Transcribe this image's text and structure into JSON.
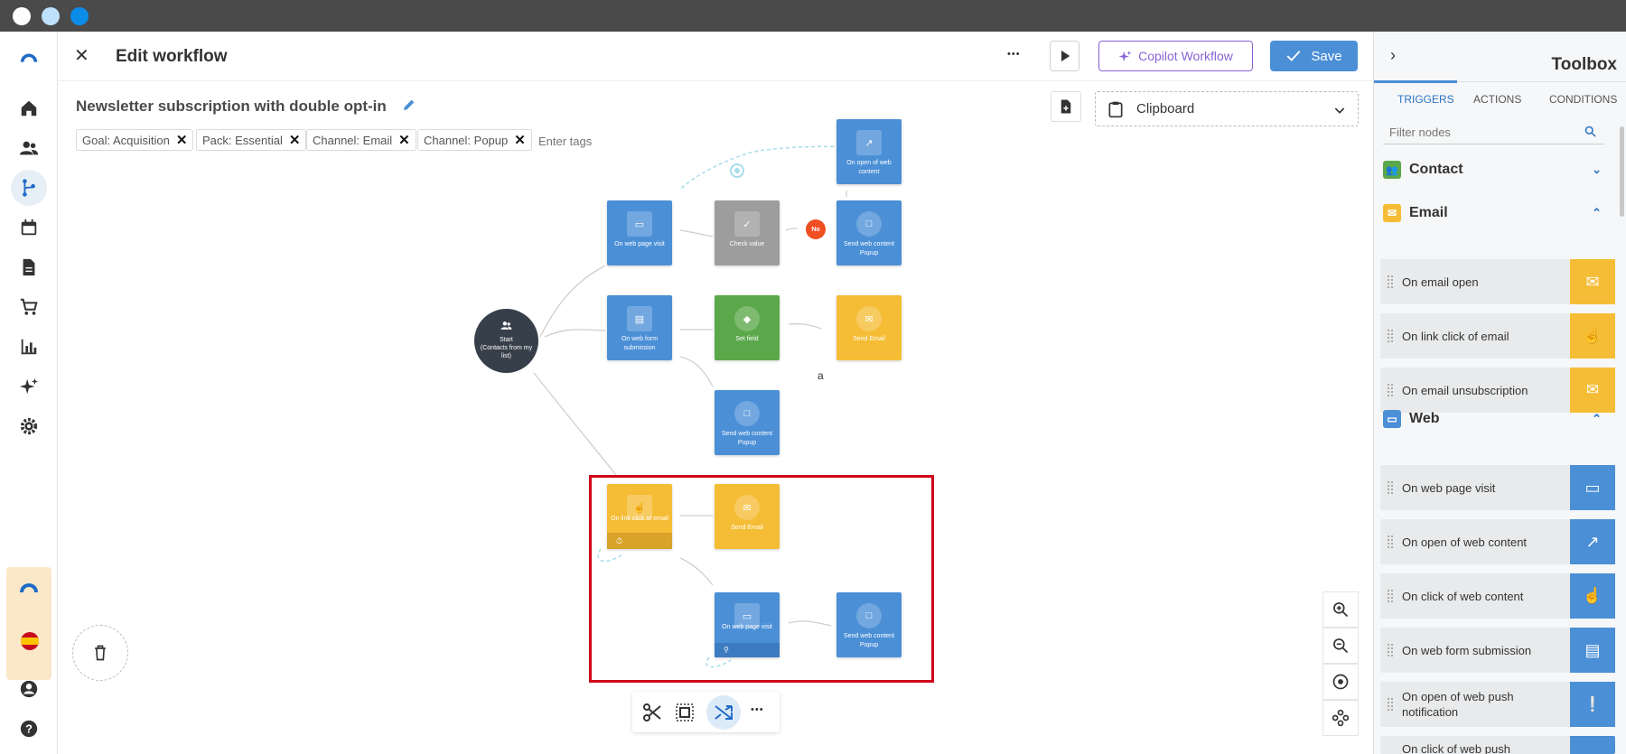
{
  "window": {
    "dots": [
      "#ffffff",
      "#bde0fb",
      "#0c8ce9"
    ]
  },
  "header": {
    "close_label": "✕",
    "title": "Edit workflow",
    "more_label": "•••",
    "copilot_label": "Copilot Workflow",
    "save_label": "Save"
  },
  "workflow": {
    "name": "Newsletter subscription with double opt-in",
    "tags": [
      "Goal: Acquisition",
      "Pack: Essential",
      "Channel: Email",
      "Channel: Popup"
    ],
    "tag_placeholder": "Enter tags"
  },
  "clipboard": {
    "label": "Clipboard"
  },
  "nodes": {
    "start": {
      "label": "Start\n(Contacts from my list)"
    },
    "web_page_visit_1": "On web page visit",
    "check_value": "Check value",
    "no_badge": "No",
    "send_web_content_1": "Send web content Popup",
    "open_web_content": "On open of web content",
    "web_form": "On web form submission",
    "set_field": "Set field",
    "send_email_1": "Send Email",
    "send_web_content_2": "Send web content Popup",
    "link_click": "On link click of email",
    "send_email_2": "Send Email",
    "web_page_visit_2": "On web page visit",
    "send_web_content_3": "Send web content Popup",
    "annotation": "a"
  },
  "toolbox": {
    "title": "Toolbox",
    "tabs": [
      "TRIGGERS",
      "ACTIONS",
      "CONDITIONS"
    ],
    "active_tab": "TRIGGERS",
    "filter_placeholder": "Filter nodes",
    "categories": {
      "contact": {
        "label": "Contact",
        "color": "#5aa84a"
      },
      "email": {
        "label": "Email",
        "color": "#f5bd35",
        "items": [
          "On email open",
          "On link click of email",
          "On email unsubscription"
        ]
      },
      "web": {
        "label": "Web",
        "color": "#4b8fd6",
        "items": [
          "On web page visit",
          "On open of web content",
          "On click of web content",
          "On web form submission",
          "On open of web push notification",
          "On click of web push"
        ]
      }
    }
  },
  "accent_color": "#4b8fd6",
  "selection_color": "#d0021b"
}
